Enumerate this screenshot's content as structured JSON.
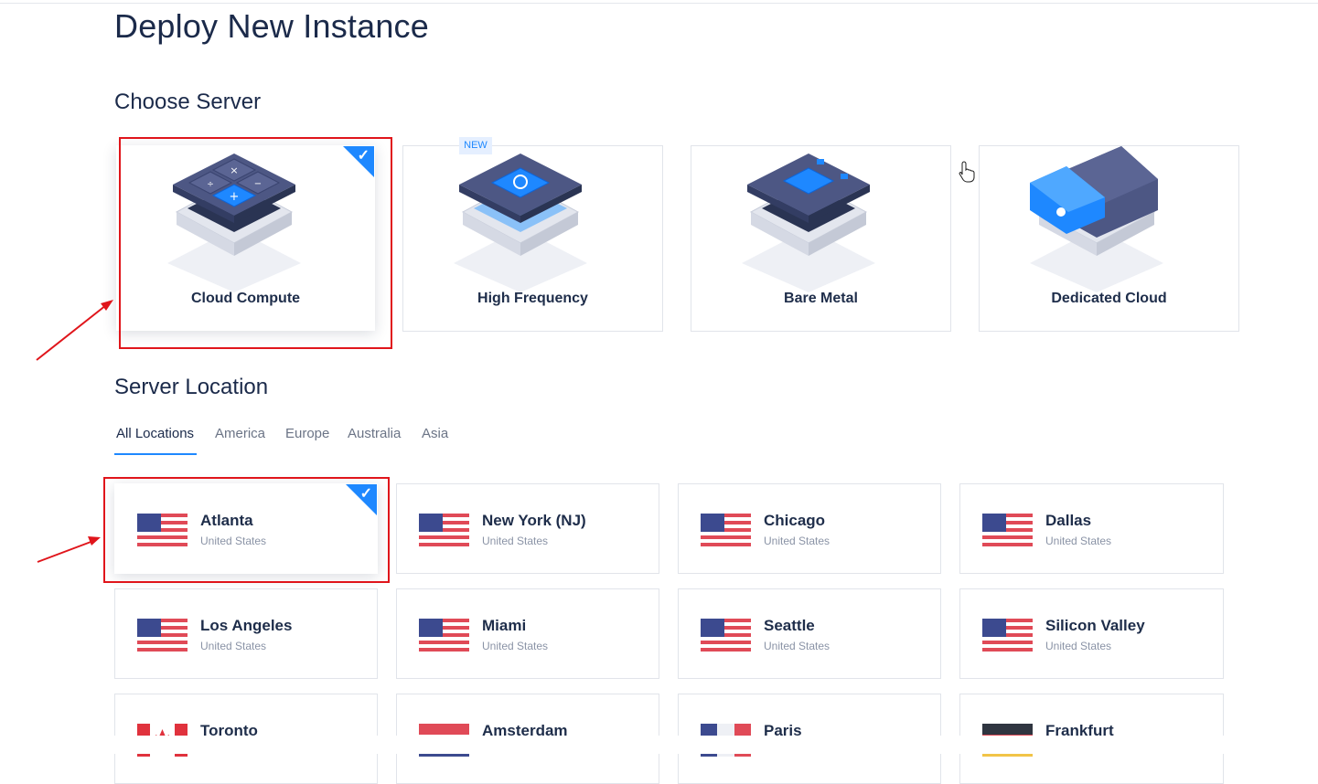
{
  "page": {
    "title": "Deploy New Instance"
  },
  "server_section": {
    "title": "Choose Server",
    "new_badge": "NEW",
    "cards": [
      {
        "label": "Cloud Compute",
        "selected": true
      },
      {
        "label": "High Frequency",
        "selected": false
      },
      {
        "label": "Bare Metal",
        "selected": false
      },
      {
        "label": "Dedicated Cloud",
        "selected": false
      }
    ]
  },
  "location_section": {
    "title": "Server Location",
    "tabs": [
      "All Locations",
      "America",
      "Europe",
      "Australia",
      "Asia"
    ],
    "active_tab": "All Locations",
    "locations": [
      {
        "name": "Atlanta",
        "country": "United States",
        "flag": "us",
        "selected": true
      },
      {
        "name": "New York (NJ)",
        "country": "United States",
        "flag": "us",
        "selected": false
      },
      {
        "name": "Chicago",
        "country": "United States",
        "flag": "us",
        "selected": false
      },
      {
        "name": "Dallas",
        "country": "United States",
        "flag": "us",
        "selected": false
      },
      {
        "name": "Los Angeles",
        "country": "United States",
        "flag": "us",
        "selected": false
      },
      {
        "name": "Miami",
        "country": "United States",
        "flag": "us",
        "selected": false
      },
      {
        "name": "Seattle",
        "country": "United States",
        "flag": "us",
        "selected": false
      },
      {
        "name": "Silicon Valley",
        "country": "United States",
        "flag": "us",
        "selected": false
      },
      {
        "name": "Toronto",
        "country": "",
        "flag": "ca",
        "selected": false
      },
      {
        "name": "Amsterdam",
        "country": "",
        "flag": "nl",
        "selected": false
      },
      {
        "name": "Paris",
        "country": "",
        "flag": "fr",
        "selected": false
      },
      {
        "name": "Frankfurt",
        "country": "",
        "flag": "de",
        "selected": false
      }
    ]
  },
  "icons": {
    "check": "checkmark-icon",
    "cursor": "hand-pointer-icon"
  },
  "colors": {
    "accent": "#1e88ff",
    "annotation": "#e0151b",
    "text": "#1b2a4a",
    "muted": "#8a93a6"
  }
}
